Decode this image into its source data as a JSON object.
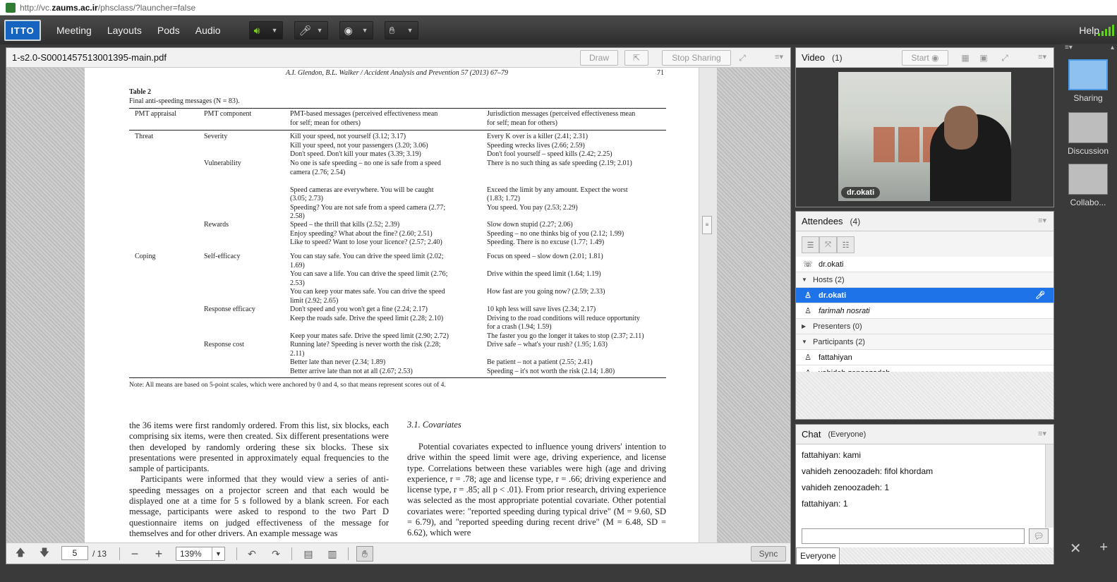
{
  "browser": {
    "url_prefix": "http://vc.",
    "url_host": "zaums.ac.ir",
    "url_suffix": "/phsclass/?launcher=false"
  },
  "menubar": {
    "logo_text": "ITTO",
    "items": [
      "Meeting",
      "Layouts",
      "Pods",
      "Audio"
    ],
    "help": "Help"
  },
  "share_pod": {
    "title": "1-s2.0-S0001457513001395-main.pdf",
    "draw": "Draw",
    "stop_sharing": "Stop Sharing",
    "toolbar": {
      "page": "5",
      "page_total": "/ 13",
      "zoom": "139%",
      "sync": "Sync"
    }
  },
  "document": {
    "running_head": "A.I. Glendon, B.L. Walker / Accident Analysis and Prevention 57 (2013) 67–79",
    "page_number": "71",
    "table_label": "Table 2",
    "table_caption": "Final anti-speeding messages (N = 83).",
    "headers": [
      "PMT appraisal",
      "PMT component",
      "PMT-based messages (perceived effectiveness mean\nfor self; mean for others)",
      "Jurisdiction messages (perceived effectiveness mean\nfor self; mean for others)"
    ],
    "rows": [
      {
        "appraisal": "Threat",
        "component": "Severity",
        "pmt": "Kill your speed, not yourself (3.12; 3.17)\nKill your speed, not your passengers (3.20; 3.06)\nDon't speed. Don't kill your mates (3.39; 3.19)",
        "jur": "Every K over is a killer (2.41; 2.31)\nSpeeding wrecks lives (2.66; 2.59)\nDon't fool yourself – speed kills (2.42; 2.25)"
      },
      {
        "appraisal": "",
        "component": "Vulnerability",
        "pmt": "No one is safe speeding – no one is safe from a speed\ncamera (2.76; 2.54)\n\nSpeed cameras are everywhere. You will be caught\n(3.05; 2.73)\nSpeeding? You are not safe from a speed camera (2.77;\n2.58)",
        "jur": "There is no such thing as safe speeding (2.19; 2.01)\n\n\nExceed the limit by any amount. Expect the worst\n(1.83; 1.72)\nYou speed. You pay (2.53; 2.29)"
      },
      {
        "appraisal": "",
        "component": "Rewards",
        "pmt": "Speed – the thrill that kills (2.52; 2.39)\nEnjoy speeding? What about the fine? (2.60; 2.51)\nLike to speed? Want to lose your licence? (2.57; 2.40)",
        "jur": "Slow down stupid (2.27; 2.06)\nSpeeding – no one thinks big of you (2.12; 1.99)\nSpeeding. There is no excuse (1.77; 1.49)"
      },
      {
        "appraisal": "Coping",
        "component": "Self-efficacy",
        "pmt": "You can stay safe. You can drive the speed limit (2.02;\n1.69)\nYou can save a life. You can drive the speed limit (2.76;\n2.53)\nYou can keep your mates safe. You can drive the speed\nlimit (2.92; 2.65)",
        "jur": "Focus on speed – slow down (2.01; 1.81)\n\nDrive within the speed limit (1.64; 1.19)\n\nHow fast are you going now? (2.59; 2.33)"
      },
      {
        "appraisal": "",
        "component": "Response efficacy",
        "pmt": "Don't speed and you won't get a fine (2.24; 2.17)\nKeep the roads safe. Drive the speed limit (2.28; 2.10)\n\nKeep your mates safe. Drive the speed limit (2.90; 2.72)",
        "jur": "10 kph less will save lives (2.34; 2.17)\nDriving to the road conditions will reduce opportunity\nfor a crash (1.94; 1.59)\nThe faster you go the longer it takes to stop (2.37; 2.11)"
      },
      {
        "appraisal": "",
        "component": "Response cost",
        "pmt": "Running late? Speeding is never worth the risk (2.28;\n2.11)\nBetter late than never (2.34; 1.89)\nBetter arrive late than not at all (2.67; 2.53)",
        "jur": "Drive safe – what's your rush? (1.95; 1.63)\n\nBe patient – not a patient (2.55; 2.41)\nSpeeding – it's not worth the risk (2.14; 1.80)"
      }
    ],
    "note": "Note: All means are based on 5-point scales, which were anchored by 0 and 4, so that means represent scores out of 4.",
    "left_col_p1": "the 36 items were first randomly ordered. From this list, six blocks, each comprising six items, were then created. Six different presentations were then developed by randomly ordering these six blocks. These six presentations were presented in approximately equal frequencies to the sample of participants.",
    "left_col_p2": "Participants were informed that they would view a series of anti-speeding messages on a projector screen and that each would be displayed one at a time for 5 s followed by a blank screen. For each message, participants were asked to respond to the two Part D questionnaire items on judged effectiveness of the message for themselves and for other drivers. An example message was",
    "section_heading": "3.1.  Covariates",
    "right_col_p1": "Potential covariates expected to influence young drivers' intention to drive within the speed limit were age, driving experience, and license type. Correlations between these variables were high (age and driving experience, r = .78; age and license type, r = .66; driving experience and license type, r = .85; all p < .01). From prior research, driving experience was selected as the most appropriate potential covariate. Other potential covariates were: \"reported speeding during typical drive\" (M = 9.60, SD = 6.79), and \"reported speeding during recent drive\" (M = 6.48, SD = 6.62), which were"
  },
  "video_pod": {
    "title": "Video",
    "count": "(1)",
    "start": "Start",
    "label": "dr.okati"
  },
  "attendees_pod": {
    "title": "Attendees",
    "count": "(4)",
    "presenter_top": "dr.okati",
    "hosts_group": "Hosts (2)",
    "hosts": [
      "dr.okati",
      "farimah nosrati"
    ],
    "presenters_group": "Presenters (0)",
    "participants_group": "Participants (2)",
    "participants": [
      "fattahiyan",
      "vahideh zenoozadeh"
    ]
  },
  "chat_pod": {
    "title": "Chat",
    "scope": "(Everyone)",
    "messages": [
      "fattahiyan: kami",
      "vahideh zenoozadeh: fifol khordam",
      "vahideh zenoozadeh: 1",
      "fattahiyan: 1"
    ],
    "tab": "Everyone"
  },
  "layouts": [
    "Sharing",
    "Discussion",
    "Collabo..."
  ],
  "colors": {
    "accent": "#1e73e8",
    "speaker_on": "#7ed321",
    "signal": "#5fd11a"
  }
}
